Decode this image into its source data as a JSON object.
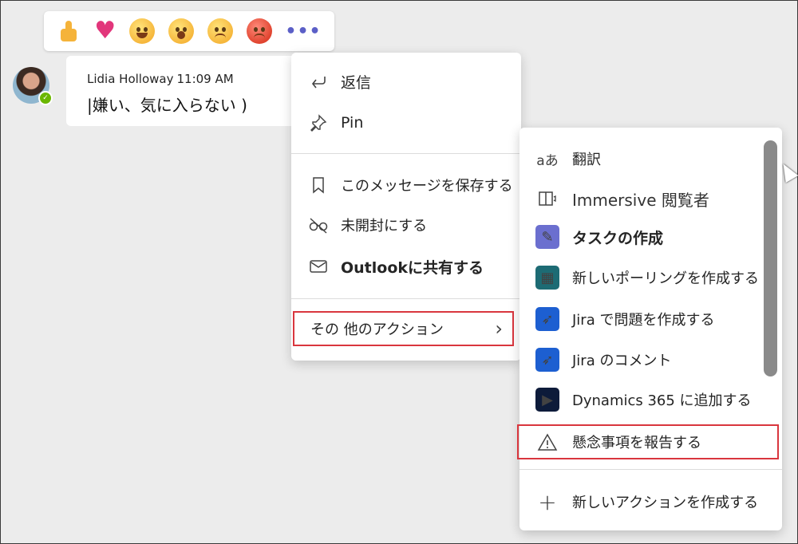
{
  "reactions": [
    "like-icon",
    "heart-icon",
    "laugh-icon",
    "surprised-icon",
    "sad-icon",
    "angry-icon"
  ],
  "reaction_more": "•••",
  "message": {
    "sender": "Lidia Holloway",
    "time": "11:09 AM",
    "text": "|嫌い、気に入らない )"
  },
  "context_menu": {
    "items": [
      {
        "label": "返信",
        "icon": "reply-icon"
      },
      {
        "label": "Pin",
        "icon": "pin-icon"
      },
      {
        "label": "このメッセージを保存する",
        "icon": "bookmark-icon"
      },
      {
        "label": "未開封にする",
        "icon": "unread-icon"
      },
      {
        "label": "Outlookに共有する",
        "icon": "mail-icon"
      }
    ],
    "more_actions": "その 他のアクション"
  },
  "submenu": {
    "items": [
      {
        "label": "翻訳",
        "icon": "translate-icon",
        "icon_text": "aあ"
      },
      {
        "label": "Immersive 閲覧者",
        "icon": "immersive-reader-icon"
      },
      {
        "label": "タスクの作成",
        "icon": "tasks-app-icon"
      },
      {
        "label": "新しいポーリングを作成する",
        "icon": "polls-app-icon"
      },
      {
        "label": "Jira で問題を作成する",
        "icon": "jira-icon"
      },
      {
        "label": "Jira のコメント",
        "icon": "jira-icon"
      },
      {
        "label": "Dynamics 365 に追加する",
        "icon": "dynamics-icon"
      },
      {
        "label": "懸念事項を報告する",
        "icon": "warning-icon"
      },
      {
        "label": "新しいアクションを作成する",
        "icon": "plus-icon"
      }
    ]
  }
}
